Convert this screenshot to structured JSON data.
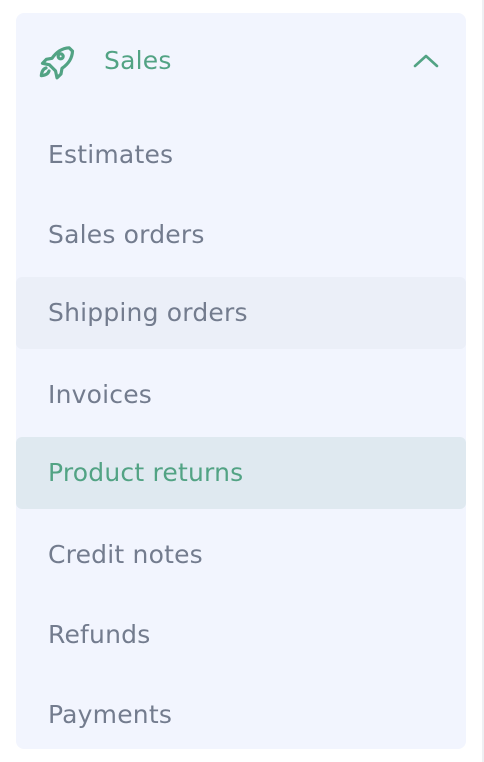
{
  "colors": {
    "accent": "#52a384",
    "text": "#737c8e",
    "panel_bg": "#f2f5fe",
    "hover_bg": "#ebeff8",
    "active_bg": "#dfe9f0"
  },
  "section": {
    "label": "Sales",
    "icon": "rocket-icon",
    "expanded": true,
    "toggle_icon": "chevron-up-icon"
  },
  "items": [
    {
      "label": "Estimates",
      "state": "default"
    },
    {
      "label": "Sales orders",
      "state": "default"
    },
    {
      "label": "Shipping orders",
      "state": "hover"
    },
    {
      "label": "Invoices",
      "state": "default"
    },
    {
      "label": "Product returns",
      "state": "active"
    },
    {
      "label": "Credit notes",
      "state": "default"
    },
    {
      "label": "Refunds",
      "state": "default"
    },
    {
      "label": "Payments",
      "state": "default"
    }
  ]
}
